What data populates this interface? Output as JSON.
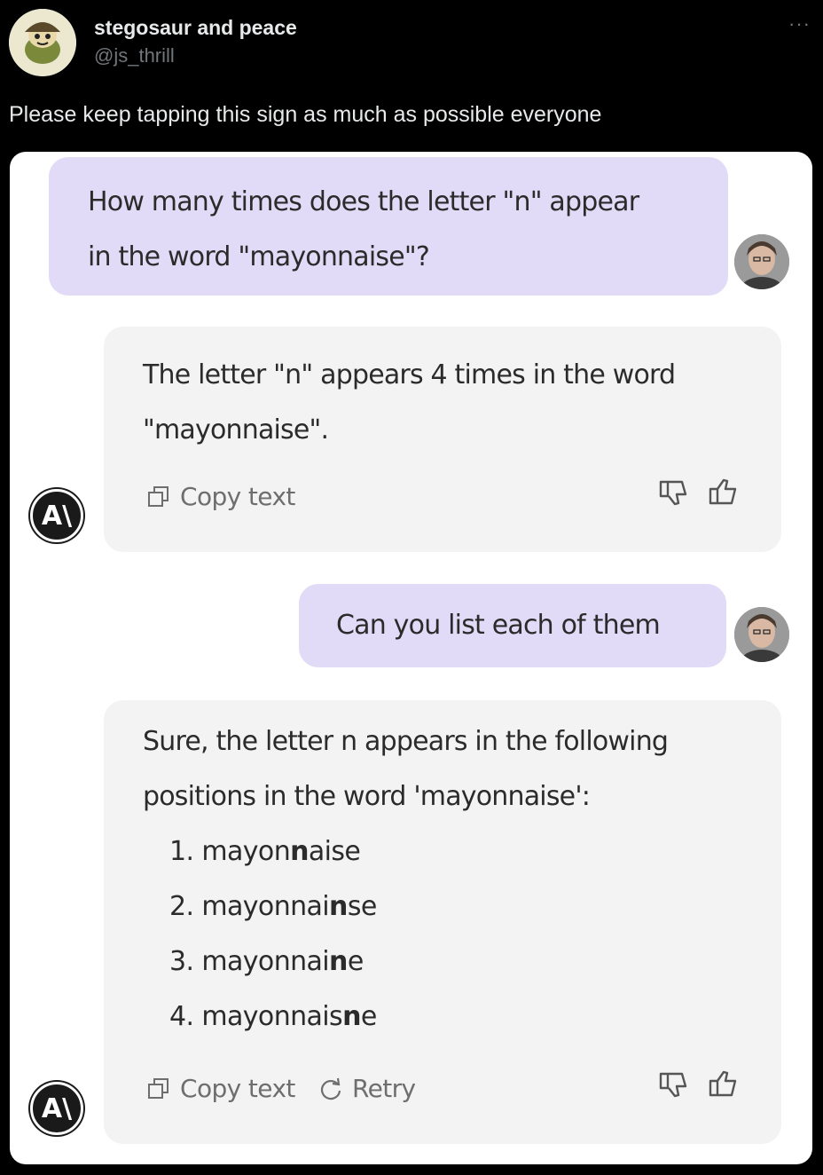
{
  "tweet": {
    "author_name": "stegosaur and peace",
    "author_handle": "@js_thrill",
    "more": "···",
    "text": "Please keep tapping this sign as much as possible everyone"
  },
  "chat": {
    "user_message_1": {
      "line1": "How many times does the letter \"n\" appear",
      "line2": "in the word \"mayonnaise\"?"
    },
    "ai_message_1": {
      "line1": "The letter \"n\" appears 4 times in the word",
      "line2": "\"mayonnaise\".",
      "copy_label": "Copy text"
    },
    "user_message_2": {
      "text": "Can you list each of them"
    },
    "ai_message_2": {
      "line1": "Sure, the letter n appears in the following",
      "line2": "positions in the word 'mayonnaise':",
      "items": [
        {
          "num": "1.",
          "pre": "mayon",
          "bold": "n",
          "post": "aise"
        },
        {
          "num": "2.",
          "pre": "mayonnai",
          "bold": "n",
          "post": "se"
        },
        {
          "num": "3.",
          "pre": "mayonnai",
          "bold": "n",
          "post": "e"
        },
        {
          "num": "4.",
          "pre": "mayonnais",
          "bold": "n",
          "post": "e"
        }
      ],
      "copy_label": "Copy text",
      "retry_label": "Retry"
    },
    "ai_logo_text": "A\\"
  },
  "colors": {
    "user_bubble": "#e2dbf7",
    "ai_bubble": "#f3f3f3",
    "background": "#000000"
  }
}
